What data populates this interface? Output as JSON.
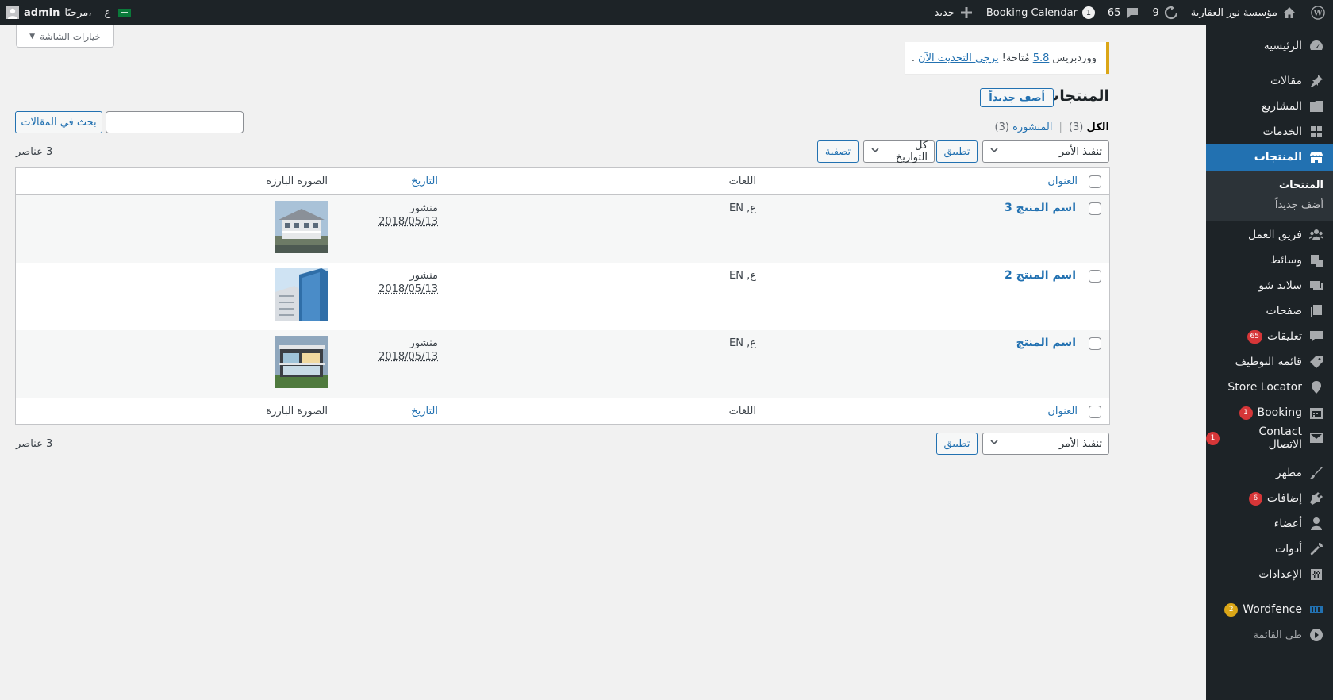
{
  "adminbar": {
    "site_name": "مؤسسة نور العقارية",
    "updates_count": "9",
    "comments_count": "65",
    "booking_label": "Booking Calendar",
    "booking_count": "1",
    "new_label": "جديد",
    "lang_label": "ع",
    "greeting": "مرحبًا،",
    "user": "admin"
  },
  "sidebar": {
    "items": [
      {
        "label": "الرئيسية",
        "icon": "dashboard-icon"
      },
      {
        "label": "مقالات",
        "icon": "pin-icon"
      },
      {
        "label": "المشاريع",
        "icon": "portfolio-icon"
      },
      {
        "label": "الخدمات",
        "icon": "grid-icon"
      },
      {
        "label": "المنتجات",
        "icon": "store-icon"
      },
      {
        "label": "فريق العمل",
        "icon": "groups-icon"
      },
      {
        "label": "وسائط",
        "icon": "media-icon"
      },
      {
        "label": "سلايد شو",
        "icon": "slides-icon"
      },
      {
        "label": "صفحات",
        "icon": "pages-icon"
      },
      {
        "label": "تعليقات",
        "icon": "comments-icon",
        "badge": "65"
      },
      {
        "label": "قائمة التوظيف",
        "icon": "tag-icon"
      },
      {
        "label": "Store Locator",
        "icon": "location-icon"
      },
      {
        "label": "Booking",
        "icon": "calendar-icon",
        "badge": "1"
      },
      {
        "label": "Contact الاتصال",
        "icon": "email-icon",
        "badge": "1"
      },
      {
        "label": "مظهر",
        "icon": "brush-icon"
      },
      {
        "label": "إضافات",
        "icon": "plugins-icon",
        "badge": "6"
      },
      {
        "label": "أعضاء",
        "icon": "users-icon"
      },
      {
        "label": "أدوات",
        "icon": "tools-icon"
      },
      {
        "label": "الإعدادات",
        "icon": "settings-icon"
      },
      {
        "label": "Wordfence",
        "icon": "wordfence-icon",
        "badge": "2"
      },
      {
        "label": "طي القائمة",
        "icon": "collapse-icon"
      }
    ],
    "submenu": [
      "المنتجات",
      "أضف جديداً"
    ]
  },
  "screen_options": "خيارات الشاشة",
  "notice": {
    "prefix": "ووردبريس",
    "version": "5.8",
    "middle": "مُتاحة!",
    "link": "يرجى التحديث الآن",
    "suffix": "."
  },
  "page": {
    "title": "المنتجات",
    "add_new": "أضف جديداً"
  },
  "views": {
    "all": "الكل",
    "all_count": "(3)",
    "sep": "|",
    "published": "المنشورة",
    "published_count": "(3)"
  },
  "search": {
    "button": "بحث في المقالات",
    "value": ""
  },
  "bulk": {
    "label": "تنفيذ الأمر",
    "apply": "تطبيق"
  },
  "dates_filter": "كل التواريخ",
  "filter_button": "تصفية",
  "items_count": "3 عناصر",
  "table": {
    "columns": {
      "title": "العنوان",
      "languages": "اللغات",
      "date": "التاريخ",
      "image": "الصورة البارزة"
    },
    "rows": [
      {
        "title": "اسم المنتج 3",
        "languages": "ع, EN",
        "status": "منشور",
        "date": "2018/05/13",
        "image": "house-white"
      },
      {
        "title": "اسم المنتج 2",
        "languages": "ع, EN",
        "status": "منشور",
        "date": "2018/05/13",
        "image": "glass-tower"
      },
      {
        "title": "اسم المنتج",
        "languages": "ع, EN",
        "status": "منشور",
        "date": "2018/05/13",
        "image": "modern-villa"
      }
    ]
  },
  "colors": {
    "accent": "#2271b1",
    "adminbar": "#1d2327",
    "notice": "#dba617",
    "badge": "#d63638"
  }
}
